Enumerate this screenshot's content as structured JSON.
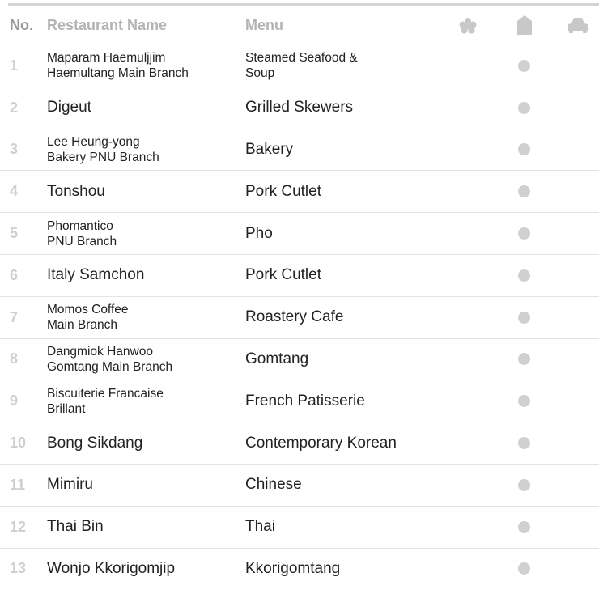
{
  "header": {
    "no": "No.",
    "name": "Restaurant Name",
    "menu": "Menu",
    "icons": [
      "flower-icon",
      "building-icon",
      "car-icon"
    ],
    "icon_color": "#c8c8c8"
  },
  "rows": [
    {
      "no": "1",
      "name_lines": [
        "Maparam Haemuljjim",
        "Haemultang Main Branch"
      ],
      "menu_lines": [
        "Steamed Seafood &",
        "Soup"
      ]
    },
    {
      "no": "2",
      "name_lines": [
        "Digeut"
      ],
      "menu_lines": [
        "Grilled Skewers"
      ]
    },
    {
      "no": "3",
      "name_lines": [
        "Lee Heung-yong",
        "Bakery PNU Branch"
      ],
      "menu_lines": [
        "Bakery"
      ]
    },
    {
      "no": "4",
      "name_lines": [
        "Tonshou"
      ],
      "menu_lines": [
        "Pork Cutlet"
      ]
    },
    {
      "no": "5",
      "name_lines": [
        "Phomantico",
        "PNU Branch"
      ],
      "menu_lines": [
        "Pho"
      ]
    },
    {
      "no": "6",
      "name_lines": [
        "Italy Samchon"
      ],
      "menu_lines": [
        "Pork Cutlet"
      ]
    },
    {
      "no": "7",
      "name_lines": [
        "Momos Coffee",
        "Main Branch"
      ],
      "menu_lines": [
        "Roastery Cafe"
      ]
    },
    {
      "no": "8",
      "name_lines": [
        "Dangmiok Hanwoo",
        "Gomtang Main Branch"
      ],
      "menu_lines": [
        "Gomtang"
      ]
    },
    {
      "no": "9",
      "name_lines": [
        "Biscuiterie Francaise",
        "Brillant"
      ],
      "menu_lines": [
        "French Patisserie"
      ]
    },
    {
      "no": "10",
      "name_lines": [
        "Bong Sikdang"
      ],
      "menu_lines": [
        "Contemporary Korean"
      ]
    },
    {
      "no": "11",
      "name_lines": [
        "Mimiru"
      ],
      "menu_lines": [
        "Chinese"
      ]
    },
    {
      "no": "12",
      "name_lines": [
        "Thai Bin"
      ],
      "menu_lines": [
        "Thai"
      ]
    },
    {
      "no": "13",
      "name_lines": [
        "Wonjo Kkorigomjip"
      ],
      "menu_lines": [
        "Kkorigomtang"
      ]
    }
  ],
  "dot_color": "#d0d0d0"
}
